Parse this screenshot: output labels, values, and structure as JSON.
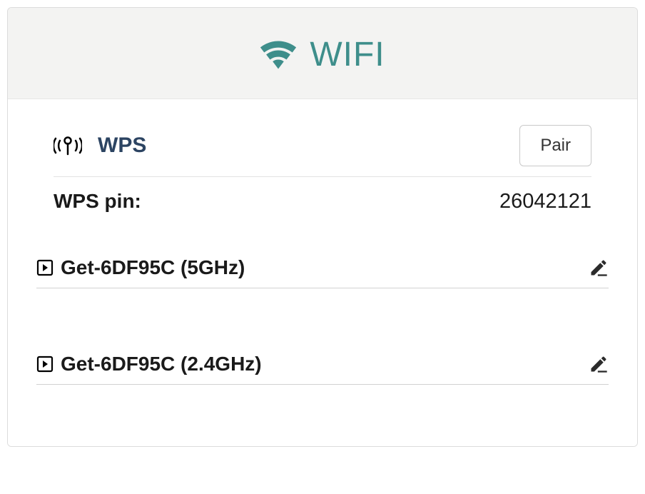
{
  "header": {
    "title": "WIFI"
  },
  "wps": {
    "label": "WPS",
    "pair_button": "Pair",
    "pin_label": "WPS pin:",
    "pin_value": "26042121"
  },
  "networks": [
    {
      "name": "Get-6DF95C (5GHz)"
    },
    {
      "name": "Get-6DF95C (2.4GHz)"
    }
  ]
}
